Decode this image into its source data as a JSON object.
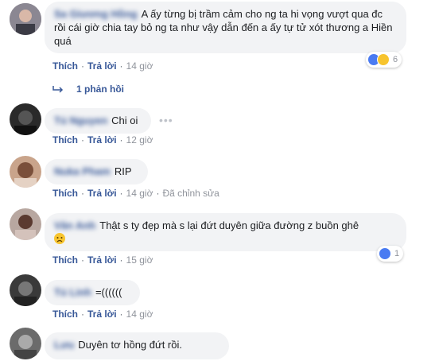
{
  "actions": {
    "like": "Thích",
    "reply": "Trả lời"
  },
  "comments": [
    {
      "author": "Sa Giương Hồng",
      "text": "A ấy từng bị trầm cảm cho ng ta hi vọng vượt qua đc rồi cái giờ chia tay bỏ ng ta như vậy dẫn đến a ấy tự tử xót thương a Hiền quá",
      "time": "14 giờ",
      "reaction_count": "6",
      "replies": "1 phản hồi"
    },
    {
      "author": "Tú Nguyen",
      "text": "Chi oi",
      "time": "12 giờ",
      "more": "•••"
    },
    {
      "author": "Nuka Pham",
      "text": "RIP",
      "time": "14 giờ",
      "edited": "Đã chỉnh sửa"
    },
    {
      "author": "Vân Anh",
      "text": "Thật s ty đẹp mà s lại đứt duyên giữa đường z buồn ghê",
      "time": "15 giờ",
      "reaction_count": "1"
    },
    {
      "author": "Tú Linh",
      "text": "=((((((",
      "time": "14 giờ"
    },
    {
      "author": "Lưu",
      "text": "Duyên tơ hồng đứt rồi."
    }
  ],
  "colors": {
    "link": "#385898",
    "bubble": "#f2f3f5",
    "like": "#4a7bf2",
    "sad": "#f7c42e"
  },
  "icons": {
    "like": "like-reaction-icon",
    "sad": "sad-reaction-icon",
    "reply_arrow": "reply-arrow-icon"
  }
}
